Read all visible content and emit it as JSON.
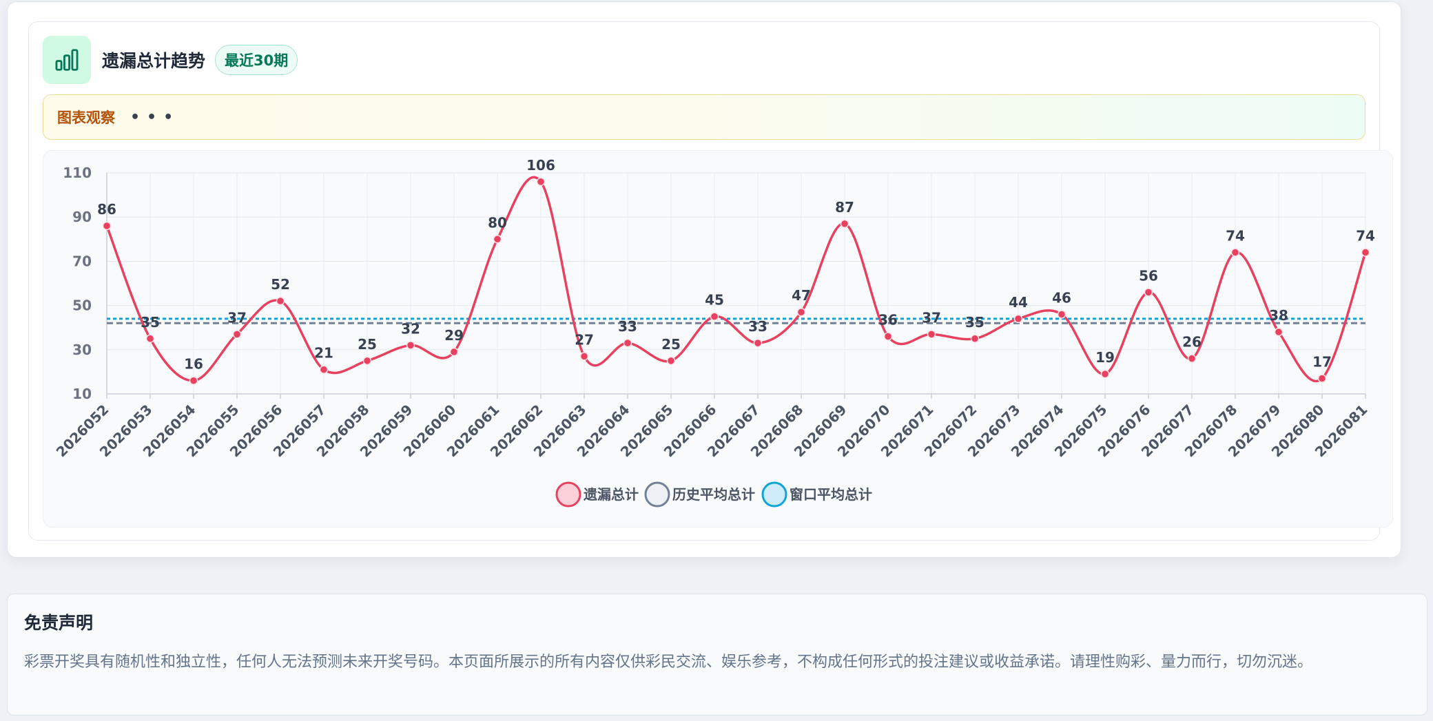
{
  "header": {
    "title": "遗漏总计趋势",
    "badge": "最近30期"
  },
  "observation": {
    "label": "图表观察",
    "dots": "•••"
  },
  "colors": {
    "series": "#e8405f",
    "history_avg": "#718096",
    "window_avg": "#0ea5d6",
    "accent_green": "#047857"
  },
  "chart_data": {
    "type": "line",
    "smooth": true,
    "x": [
      "2026052",
      "2026053",
      "2026054",
      "2026055",
      "2026056",
      "2026057",
      "2026058",
      "2026059",
      "2026060",
      "2026061",
      "2026062",
      "2026063",
      "2026064",
      "2026065",
      "2026066",
      "2026067",
      "2026068",
      "2026069",
      "2026070",
      "2026071",
      "2026072",
      "2026073",
      "2026074",
      "2026075",
      "2026076",
      "2026077",
      "2026078",
      "2026079",
      "2026080",
      "2026081"
    ],
    "series": [
      {
        "name": "遗漏总计",
        "values": [
          86,
          35,
          16,
          37,
          52,
          21,
          25,
          32,
          29,
          80,
          106,
          27,
          33,
          25,
          45,
          33,
          47,
          87,
          36,
          37,
          35,
          44,
          46,
          19,
          56,
          26,
          74,
          38,
          17,
          74
        ],
        "color": "#e8405f"
      },
      {
        "name": "历史平均总计",
        "constant": 42,
        "style": "dashed",
        "color": "#718096"
      },
      {
        "name": "窗口平均总计",
        "constant": 44,
        "style": "dotted",
        "color": "#0ea5d6"
      }
    ],
    "yticks": [
      10,
      30,
      50,
      70,
      90,
      110
    ],
    "ylim": [
      10,
      110
    ],
    "grid": true,
    "data_labels": true,
    "legend_position": "bottom-center"
  },
  "disclaimer": {
    "title": "免责声明",
    "text": "彩票开奖具有随机性和独立性，任何人无法预测未来开奖号码。本页面所展示的所有内容仅供彩民交流、娱乐参考，不构成任何形式的投注建议或收益承诺。请理性购彩、量力而行，切勿沉迷。"
  }
}
